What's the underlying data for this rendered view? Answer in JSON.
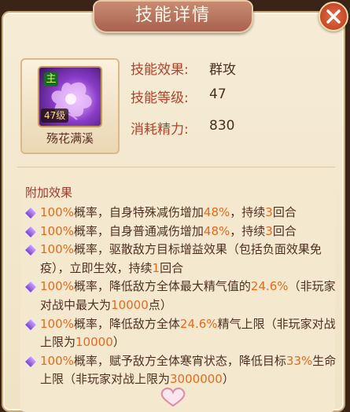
{
  "title": "技能详情",
  "close_icon": "close-icon",
  "skill": {
    "name": "殇花满溪",
    "level_badge": "47级",
    "icon_tag": "主"
  },
  "stats": [
    {
      "label": "技能效果:",
      "value": "群攻"
    },
    {
      "label": "技能等级:",
      "value": "47"
    },
    {
      "label": "消耗精力:",
      "value": "830"
    }
  ],
  "effects": {
    "title": "附加效果",
    "items": [
      {
        "parts": [
          {
            "t": "100%",
            "hl": true
          },
          {
            "t": "概率，自身特殊减伤增加"
          },
          {
            "t": "48%",
            "hl": true
          },
          {
            "t": "，持续"
          },
          {
            "t": "3",
            "hl": true
          },
          {
            "t": "回合"
          }
        ]
      },
      {
        "parts": [
          {
            "t": "100%",
            "hl": true
          },
          {
            "t": "概率，自身普通减伤增加"
          },
          {
            "t": "48%",
            "hl": true
          },
          {
            "t": "，持续"
          },
          {
            "t": "3",
            "hl": true
          },
          {
            "t": "回合"
          }
        ]
      },
      {
        "parts": [
          {
            "t": "100%",
            "hl": true
          },
          {
            "t": "概率，驱散敌方目标增益效果（包括负面效果免疫），立即生效，持续"
          },
          {
            "t": "1",
            "hl": true
          },
          {
            "t": "回合"
          }
        ]
      },
      {
        "parts": [
          {
            "t": "100%",
            "hl": true
          },
          {
            "t": "概率，降低敌方全体最大精气值的"
          },
          {
            "t": "24.6%",
            "hl": true
          },
          {
            "t": "（非玩家对战中最大为"
          },
          {
            "t": "10000",
            "hl": true
          },
          {
            "t": "点）"
          }
        ]
      },
      {
        "parts": [
          {
            "t": "100%",
            "hl": true
          },
          {
            "t": "概率，降低敌方全体"
          },
          {
            "t": "24.6%",
            "hl": true
          },
          {
            "t": "精气上限（非玩家对战上限为"
          },
          {
            "t": "10000",
            "hl": true
          },
          {
            "t": "）"
          }
        ]
      },
      {
        "parts": [
          {
            "t": "100%",
            "hl": true
          },
          {
            "t": "概率，赋予敌方全体寒宵状态，降低目标"
          },
          {
            "t": "33%",
            "hl": true
          },
          {
            "t": "生命上限（非玩家对战上限为"
          },
          {
            "t": "3000000",
            "hl": true
          },
          {
            "t": "）"
          }
        ]
      }
    ]
  },
  "colors": {
    "highlight": "#e86a1d",
    "label": "#b5422a",
    "text": "#4e3021",
    "panel": "#f6ecd6"
  }
}
